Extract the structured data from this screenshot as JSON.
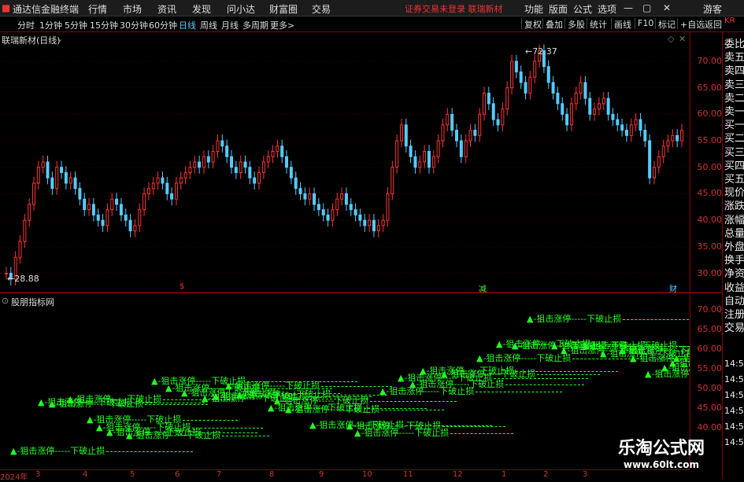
{
  "app": {
    "title": "通达信金融终端",
    "menu": [
      "行情",
      "市场",
      "资讯",
      "发现",
      "问小达",
      "财富圈",
      "交易"
    ],
    "notice": "证券交易未登录  联瑞新材",
    "right_menu": [
      "功能",
      "版面",
      "公式",
      "选项"
    ],
    "guest": "游客"
  },
  "periods": [
    "分时",
    "1分钟",
    "5分钟",
    "15分钟",
    "30分钟",
    "60分钟",
    "日线",
    "周线",
    "月线",
    "多周期",
    "更多>"
  ],
  "active_period": "日线",
  "tools": [
    "复权",
    "叠加",
    "多股",
    "统计",
    "画线",
    "F10",
    "标记",
    "+自选",
    "返回"
  ],
  "main_chart": {
    "title": "联瑞新材(日线)",
    "y_ticks": [
      "70.00",
      "65.00",
      "60.00",
      "55.00",
      "50.00",
      "45.00",
      "40.00",
      "35.00",
      "30.00"
    ],
    "high_label": "72.37",
    "low_label": "28.88",
    "markers": [
      "$",
      "减",
      "财"
    ]
  },
  "indicator": {
    "title": "股朋指标网",
    "y_ticks": [
      "70.00",
      "65.00",
      "60.00",
      "55.00",
      "50.00",
      "45.00",
      "40.00"
    ],
    "signal_text": "▲-狙击涨停-----下破止损",
    "right_times": [
      "14:50",
      "14:50",
      "14:50",
      "14:50",
      "14:50",
      "14:50"
    ]
  },
  "right_panel": [
    "委比",
    "卖五",
    "卖四",
    "卖三",
    "卖二",
    "卖一",
    "买一",
    "买二",
    "买三",
    "买四",
    "买五",
    "现价",
    "涨跌",
    "涨幅",
    "总量",
    "外盘",
    "换手",
    "净资",
    "收益",
    "自动",
    "注册",
    "交易"
  ],
  "right_top": "KR",
  "dates": [
    "2024年",
    "3",
    "4",
    "5",
    "6",
    "7",
    "8",
    "9",
    "10",
    "11",
    "12",
    "1",
    "2",
    "3"
  ],
  "watermark": {
    "line1": "乐淘公式网",
    "line2": "www.60lt.com"
  },
  "chart_data": {
    "type": "candlestick",
    "ylim": [
      28,
      74
    ],
    "close": [
      30,
      28.9,
      33,
      36,
      40,
      43,
      47,
      50,
      51,
      48,
      46,
      50,
      49,
      47,
      48,
      46,
      44,
      42,
      43,
      41,
      40,
      39,
      42,
      44,
      43,
      41,
      40,
      38,
      39,
      42,
      45,
      46,
      47,
      48,
      47,
      45,
      44,
      47,
      48,
      49,
      50,
      51,
      50,
      52,
      51,
      53,
      55,
      54,
      52,
      50,
      49,
      51,
      50,
      48,
      47,
      49,
      51,
      52,
      53,
      54,
      52,
      50,
      48,
      46,
      45,
      44,
      45,
      43,
      42,
      41,
      40,
      42,
      44,
      45,
      43,
      42,
      41,
      40,
      39,
      40,
      38,
      39,
      40,
      45,
      50,
      55,
      58,
      54,
      52,
      50,
      51,
      53,
      50,
      52,
      55,
      58,
      60,
      57,
      55,
      52,
      55,
      57,
      56,
      60,
      64,
      62,
      59,
      58,
      61,
      65,
      70,
      68,
      66,
      64,
      67,
      70,
      72,
      69,
      66,
      64,
      62,
      60,
      58,
      62,
      64,
      66,
      63,
      60,
      61,
      62,
      63,
      60,
      59,
      58,
      57,
      56,
      58,
      59,
      57,
      55,
      48,
      50,
      52,
      54,
      55,
      56,
      55,
      57
    ],
    "series": [
      {
        "name": "",
        "points": [
          [
            13,
            572
          ],
          [
            192,
            480
          ],
          [
            218,
            484
          ],
          [
            286,
            492
          ],
          [
            348,
            508
          ],
          [
            393,
            500
          ],
          [
            482,
            498
          ],
          [
            533,
            474
          ],
          [
            605,
            452
          ],
          [
            669,
            402
          ],
          [
            762,
            448
          ],
          [
            819,
            474
          ]
        ]
      }
    ]
  }
}
